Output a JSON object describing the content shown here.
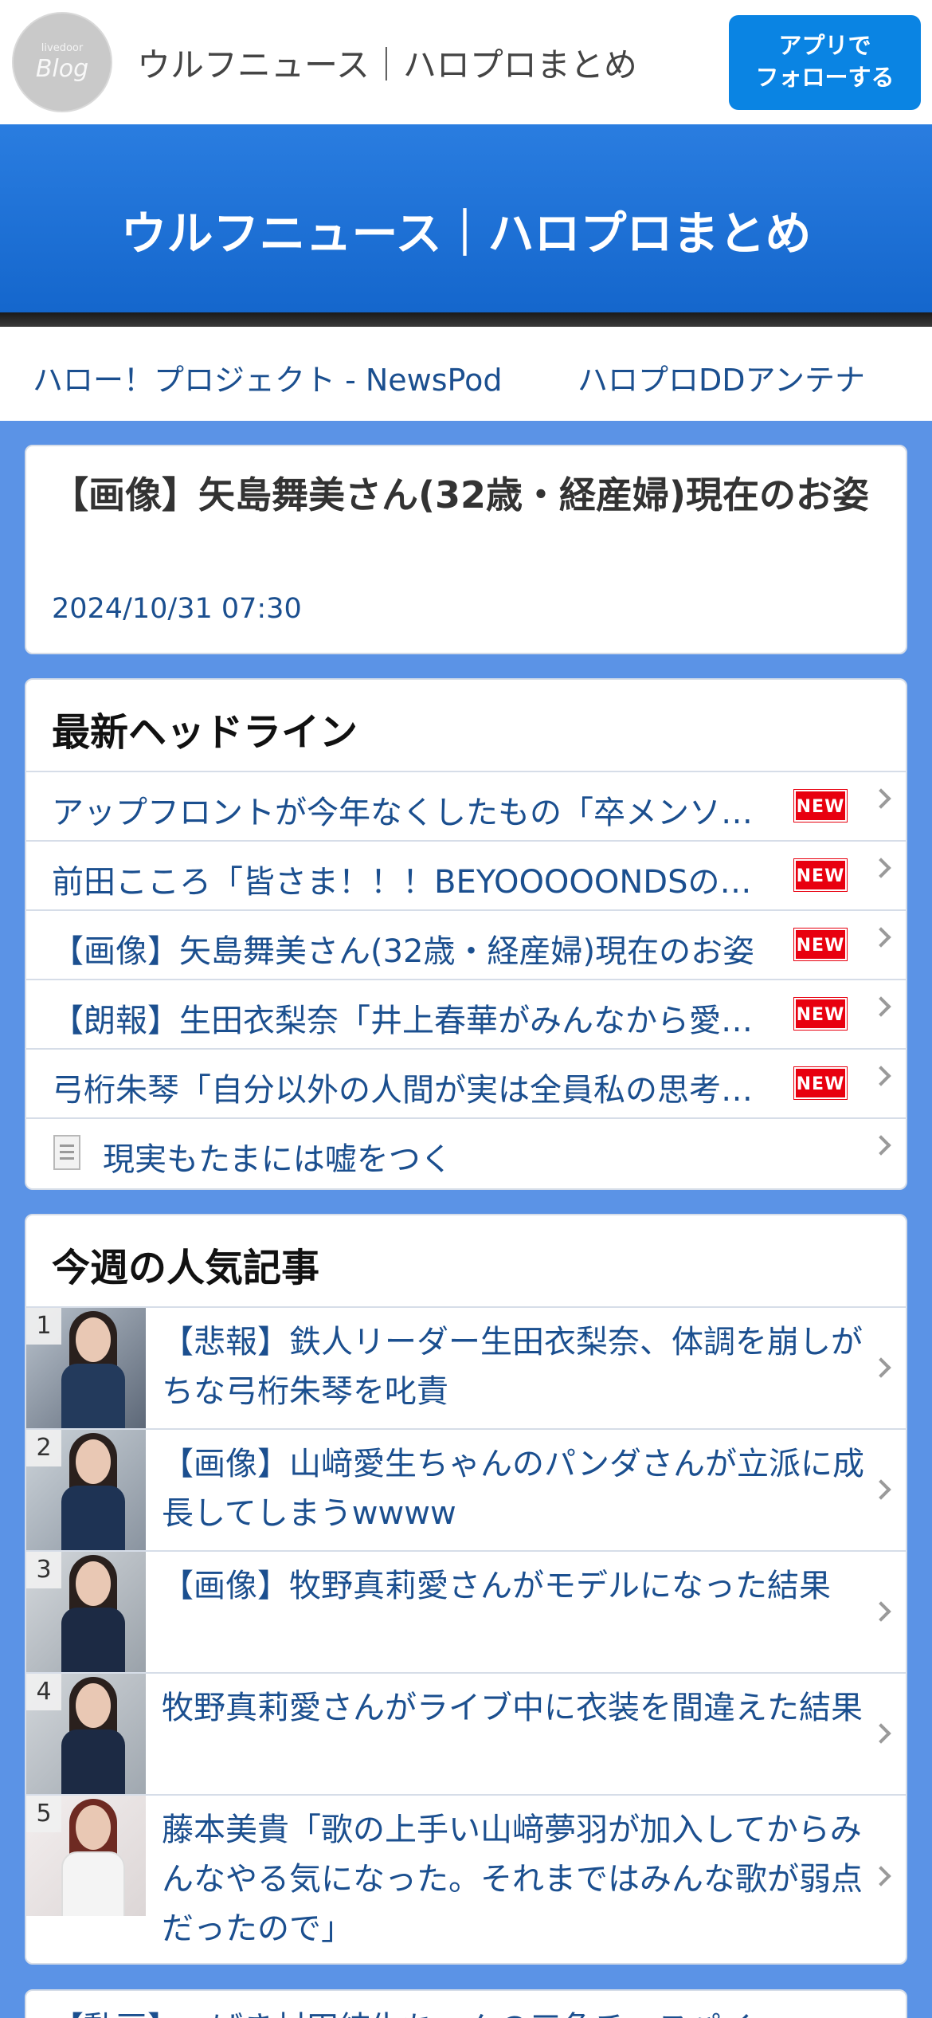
{
  "appbar": {
    "logo_small": "livedoor",
    "logo_big": "Blog",
    "site_name": "ウルフニュース｜ハロプロまとめ",
    "follow_line1": "アプリで",
    "follow_line2": "フォローする"
  },
  "banner": {
    "title": "ウルフニュース｜ハロプロまとめ"
  },
  "links": [
    {
      "label": "ハロー！プロジェクト - NewsPod"
    },
    {
      "label": "ハロプロDDアンテナ"
    }
  ],
  "article": {
    "title": "【画像】矢島舞美さん(32歳・経産婦)現在のお姿",
    "date": "2024/10/31 07:30"
  },
  "headlines": {
    "heading": "最新ヘッドライン",
    "badge": "NEW",
    "items": [
      {
        "text": "アップフロントが今年なくしたもの「卒メンソ…"
      },
      {
        "text": "前田こころ「皆さま！！！BEYOOOOONDSの…"
      },
      {
        "text": "【画像】矢島舞美さん(32歳・経産婦)現在のお姿"
      },
      {
        "text": "【朗報】生田衣梨奈「井上春華がみんなから愛…"
      },
      {
        "text": "弓桁朱琴「自分以外の人間が実は全員私の思考…"
      },
      {
        "text": "現実もたまには嘘をつく"
      }
    ]
  },
  "popular": {
    "heading": "今週の人気記事",
    "items": [
      {
        "rank": "1",
        "text": "【悲報】鉄人リーダー生田衣梨奈、体調を崩しがちな弓桁朱琴を叱責"
      },
      {
        "rank": "2",
        "text": "【画像】山﨑愛生ちゃんのパンダさんが立派に成長してしまうwwww"
      },
      {
        "rank": "3",
        "text": "【画像】牧野真莉愛さんがモデルになった結果"
      },
      {
        "rank": "4",
        "text": "牧野真莉愛さんがライブ中に衣装を間違えた結果"
      },
      {
        "rank": "5",
        "text": "藤本美貴「歌の上手い山﨑夢羽が加入してからみんなやる気になった。それまではみんな歌が弱点だったので」"
      }
    ]
  },
  "next_card": {
    "text": "【動画】つばき村田結生ちゃんの三角チ…スパイ"
  }
}
